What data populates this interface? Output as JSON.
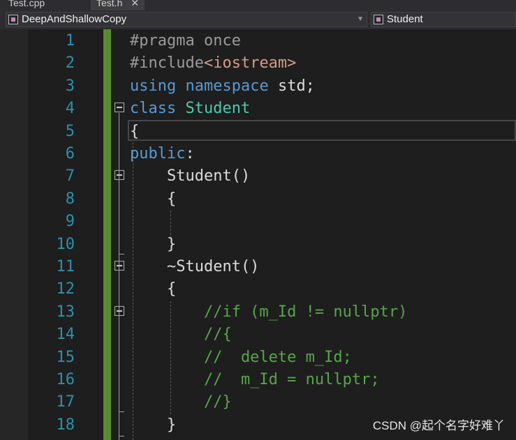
{
  "tabs": [
    {
      "label": "Test.cpp"
    },
    {
      "label": "Test.h",
      "close": "✕"
    }
  ],
  "nav": {
    "scope": "DeepAndShallowCopy",
    "member": "Student"
  },
  "lines": [
    {
      "n": "1",
      "tokens": [
        {
          "t": "#pragma once",
          "c": "pp"
        }
      ]
    },
    {
      "n": "2",
      "tokens": [
        {
          "t": "#include",
          "c": "pp"
        },
        {
          "t": "<iostream>",
          "c": "str"
        }
      ]
    },
    {
      "n": "3",
      "tokens": [
        {
          "t": "using",
          "c": "kw"
        },
        {
          "t": " "
        },
        {
          "t": "namespace",
          "c": "kw"
        },
        {
          "t": " std;"
        }
      ]
    },
    {
      "n": "4",
      "tokens": [
        {
          "t": "class",
          "c": "kw"
        },
        {
          "t": " "
        },
        {
          "t": "Student",
          "c": "ty"
        }
      ]
    },
    {
      "n": "5",
      "tokens": [
        {
          "t": "{"
        }
      ]
    },
    {
      "n": "6",
      "tokens": [
        {
          "t": "public",
          "c": "kw"
        },
        {
          "t": ":"
        }
      ]
    },
    {
      "n": "7",
      "tokens": [
        {
          "t": "    Student()"
        }
      ]
    },
    {
      "n": "8",
      "tokens": [
        {
          "t": "    {"
        }
      ]
    },
    {
      "n": "9",
      "tokens": [
        {
          "t": ""
        }
      ]
    },
    {
      "n": "10",
      "tokens": [
        {
          "t": "    }"
        }
      ]
    },
    {
      "n": "11",
      "tokens": [
        {
          "t": "    ~Student()"
        }
      ]
    },
    {
      "n": "12",
      "tokens": [
        {
          "t": "    {"
        }
      ]
    },
    {
      "n": "13",
      "tokens": [
        {
          "t": "        //if (m_Id != nullptr)",
          "c": "cm"
        }
      ]
    },
    {
      "n": "14",
      "tokens": [
        {
          "t": "        //{",
          "c": "cm"
        }
      ]
    },
    {
      "n": "15",
      "tokens": [
        {
          "t": "        //  delete m_Id;",
          "c": "cm"
        }
      ]
    },
    {
      "n": "16",
      "tokens": [
        {
          "t": "        //  m_Id = nullptr;",
          "c": "cm"
        }
      ]
    },
    {
      "n": "17",
      "tokens": [
        {
          "t": "        //}",
          "c": "cm"
        }
      ]
    },
    {
      "n": "18",
      "tokens": [
        {
          "t": "    }"
        }
      ]
    }
  ],
  "watermark": "CSDN @起个名字好难丫"
}
